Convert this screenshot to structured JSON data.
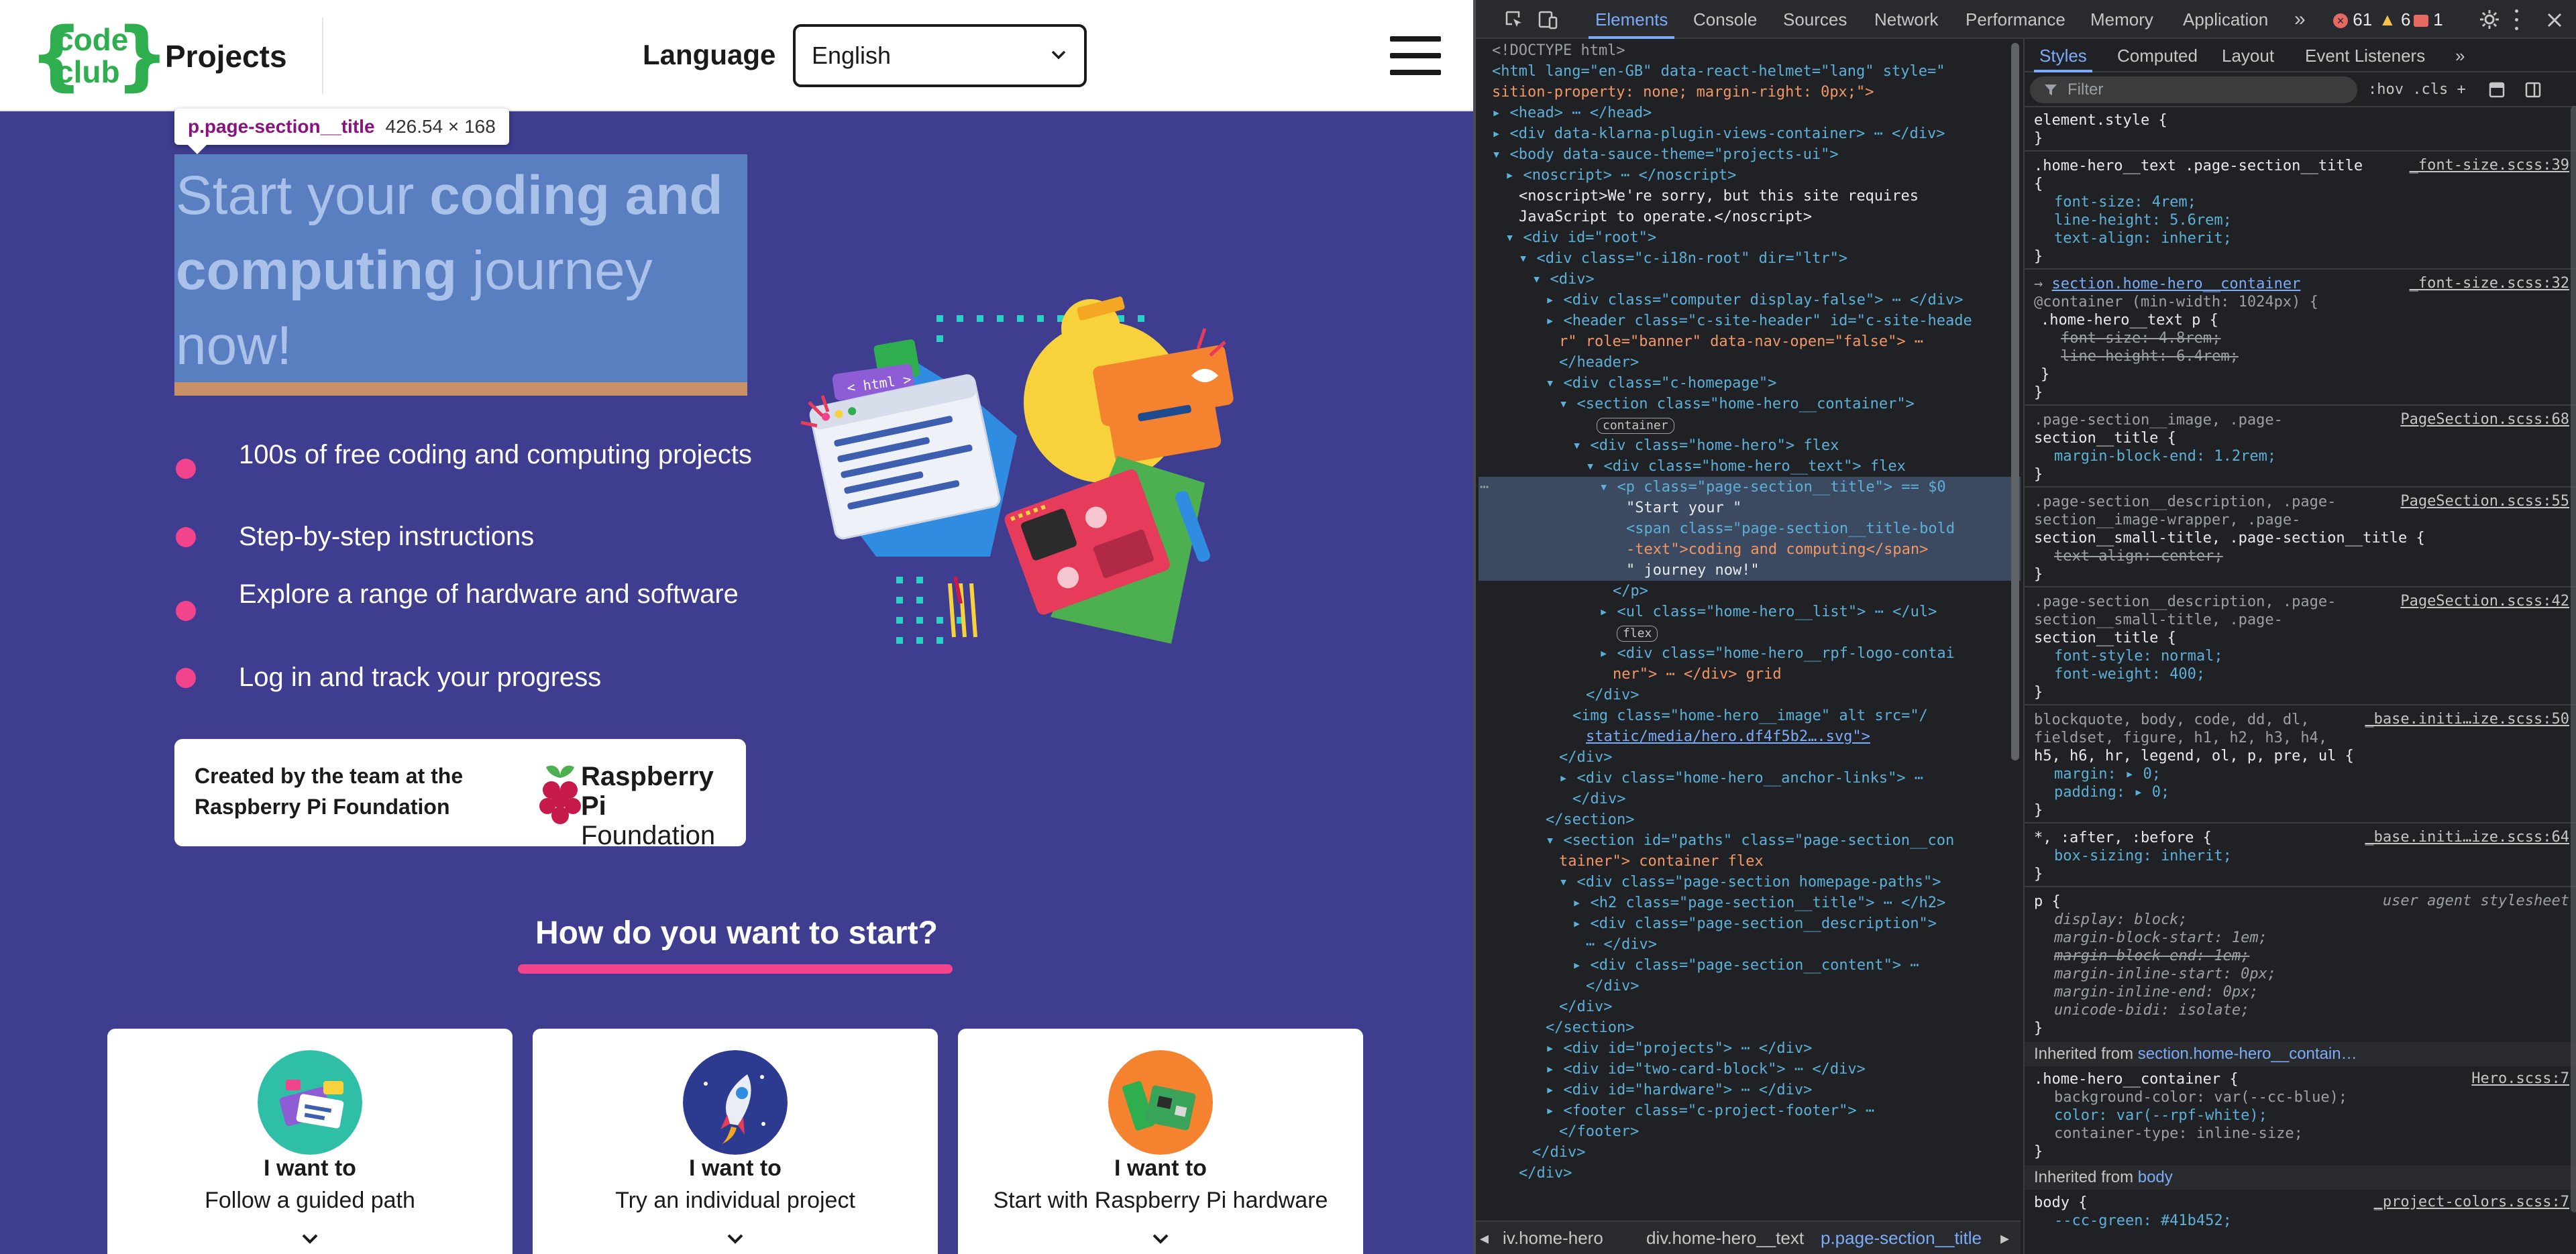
{
  "site": {
    "logo_line1": "code",
    "logo_line2": "club",
    "title": "Projects",
    "language_label": "Language",
    "language_value": "English",
    "tooltip_name": "p.page-section__title",
    "tooltip_size": "426.54 × 168",
    "hero_title_start": "Start your ",
    "hero_title_bold": "coding and computing",
    "hero_title_end": " journey now!",
    "hero_items": [
      "100s of free coding and computing projects",
      "Step-by-step instructions",
      "Explore a range of hardware and software",
      "Log in and track your progress"
    ],
    "rpf_text": "Created by the team at the Raspberry Pi Foundation",
    "rpf_brand_1": "Raspberry Pi",
    "rpf_brand_2": "Foundation",
    "art_html_label": "< html >",
    "paths_title": "How do you want to start?",
    "path_cards": [
      {
        "want": "I want to",
        "label": "Follow a guided path"
      },
      {
        "want": "I want to",
        "label": "Try an individual project"
      },
      {
        "want": "I want to",
        "label": "Start with Raspberry Pi hardware"
      }
    ],
    "colors": {
      "background": "#3e3d8f",
      "accent_pink": "#f2448d",
      "logo_green": "#2fae4f",
      "highlight_overlay": "#5a7fc0"
    }
  },
  "devtools": {
    "tabs": [
      "Elements",
      "Console",
      "Sources",
      "Network",
      "Performance",
      "Memory",
      "Application"
    ],
    "more_tabs": "»",
    "errors": "61",
    "warnings": "6",
    "issues": "1",
    "dom_lines": [
      "<!DOCTYPE html>",
      "<html lang=\"en-GB\" data-react-helmet=\"lang\" style=\"",
      "sition-property: none; margin-right: 0px;\">",
      "▸ <head> ⋯ </head>",
      "▸ <div data-klarna-plugin-views-container> ⋯ </div>",
      "▾ <body data-sauce-theme=\"projects-ui\">",
      "▸ <noscript> ⋯ </noscript>",
      "<noscript>We're sorry, but this site requires",
      "JavaScript to operate.</noscript>",
      "▾ <div id=\"root\">",
      "▾ <div class=\"c-i18n-root\" dir=\"ltr\">",
      "▾ <div>",
      "▸ <div class=\"computer display-false\"> ⋯ </div>",
      "▸ <header class=\"c-site-header\" id=\"c-site-heade",
      "r\" role=\"banner\" data-nav-open=\"false\"> ⋯",
      "</header>",
      "▾ <div class=\"c-homepage\">",
      "▾ <section class=\"home-hero__container\">",
      "container",
      "▾ <div class=\"home-hero\"> flex",
      "▾ <div class=\"home-hero__text\"> flex",
      "▾ <p class=\"page-section__title\"> == $0",
      "\"Start your \"",
      "<span class=\"page-section__title-bold",
      "-text\">coding and computing</span>",
      "\" journey now!\"",
      "</p>",
      "▸ <ul class=\"home-hero__list\"> ⋯ </ul>",
      "flex",
      "▸ <div class=\"home-hero__rpf-logo-contai",
      "ner\"> ⋯ </div> grid",
      "</div>",
      "<img class=\"home-hero__image\" alt src=\"/",
      "static/media/hero.df4f5b2….svg\">",
      "</div>",
      "▸ <div class=\"home-hero__anchor-links\"> ⋯",
      "</div>",
      "</section>",
      "▾ <section id=\"paths\" class=\"page-section__con",
      "tainer\"> container flex",
      "▾ <div class=\"page-section homepage-paths\">",
      "▸ <h2 class=\"page-section__title\"> ⋯ </h2>",
      "▸ <div class=\"page-section__description\">",
      "⋯ </div>",
      "▸ <div class=\"page-section__content\"> ⋯",
      "</div>",
      "</div>",
      "</section>",
      "▸ <div id=\"projects\"> ⋯ </div>",
      "▸ <div id=\"two-card-block\"> ⋯ </div>",
      "▸ <div id=\"hardware\"> ⋯ </div>",
      "▸ <footer class=\"c-project-footer\"> ⋯",
      "</footer>",
      "</div>",
      "</div>"
    ],
    "breadcrumbs": [
      "iv.home-hero",
      "div.home-hero__text",
      "p.page-section__title"
    ],
    "styles_tabs": [
      "Styles",
      "Computed",
      "Layout",
      "Event Listeners"
    ],
    "filter_placeholder": "Filter",
    "filter_tools": ":hov  .cls  +",
    "style_lines": [
      "element.style {",
      "}",
      ".home-hero__text .page-section__title",
      "{",
      "font-size: 4rem;",
      "line-height: 5.6rem;",
      "text-align: inherit;",
      "}",
      "section.home-hero__container",
      "@container (min-width: 1024px) {",
      ".home-hero__text p {",
      "font-size: 4.8rem;",
      "line-height: 6.4rem;",
      "}",
      "}",
      ".page-section__image, .page-",
      "section__title {",
      "margin-block-end: 1.2rem;",
      "}",
      ".page-section__description, .page-",
      "section__image-wrapper, .page-",
      "section__small-title, .page-section__title {",
      "text-align: center;",
      "}",
      ".page-section__description, .page-",
      "section__small-title, .page-",
      "section__title {",
      "font-style: normal;",
      "font-weight: 400;",
      "}",
      "blockquote, body, code, dd, dl,",
      "fieldset, figure, h1, h2, h3, h4,",
      "h5, h6, hr, legend, ol, p, pre, ul {",
      "margin: ▸ 0;",
      "padding: ▸ 0;",
      "}",
      "*, :after, :before {",
      "box-sizing: inherit;",
      "}",
      "p {",
      "display: block;",
      "margin-block-start: 1em;",
      "margin-block-end: 1em;",
      "margin-inline-start: 0px;",
      "margin-inline-end: 0px;",
      "unicode-bidi: isolate;",
      "}",
      ".home-hero__container {",
      "background-color: var(--cc-blue);",
      "color: var(--rpf-white);",
      "container-type: inline-size;",
      "}",
      "body {",
      "--cc-green: #41b452;"
    ],
    "style_sources": [
      "_font-size.scss:39",
      "_font-size.scss:32",
      "PageSection.scss:68",
      "PageSection.scss:55",
      "PageSection.scss:42",
      "_base.initi…ize.scss:50",
      "_base.initi…ize.scss:64",
      "user agent stylesheet",
      "Hero.scss:7",
      "_project-colors.scss:7"
    ],
    "inherited_1_prefix": "Inherited from ",
    "inherited_1_sel": "section.home-hero__contain…",
    "inherited_2_prefix": "Inherited from ",
    "inherited_2_sel": "body"
  }
}
